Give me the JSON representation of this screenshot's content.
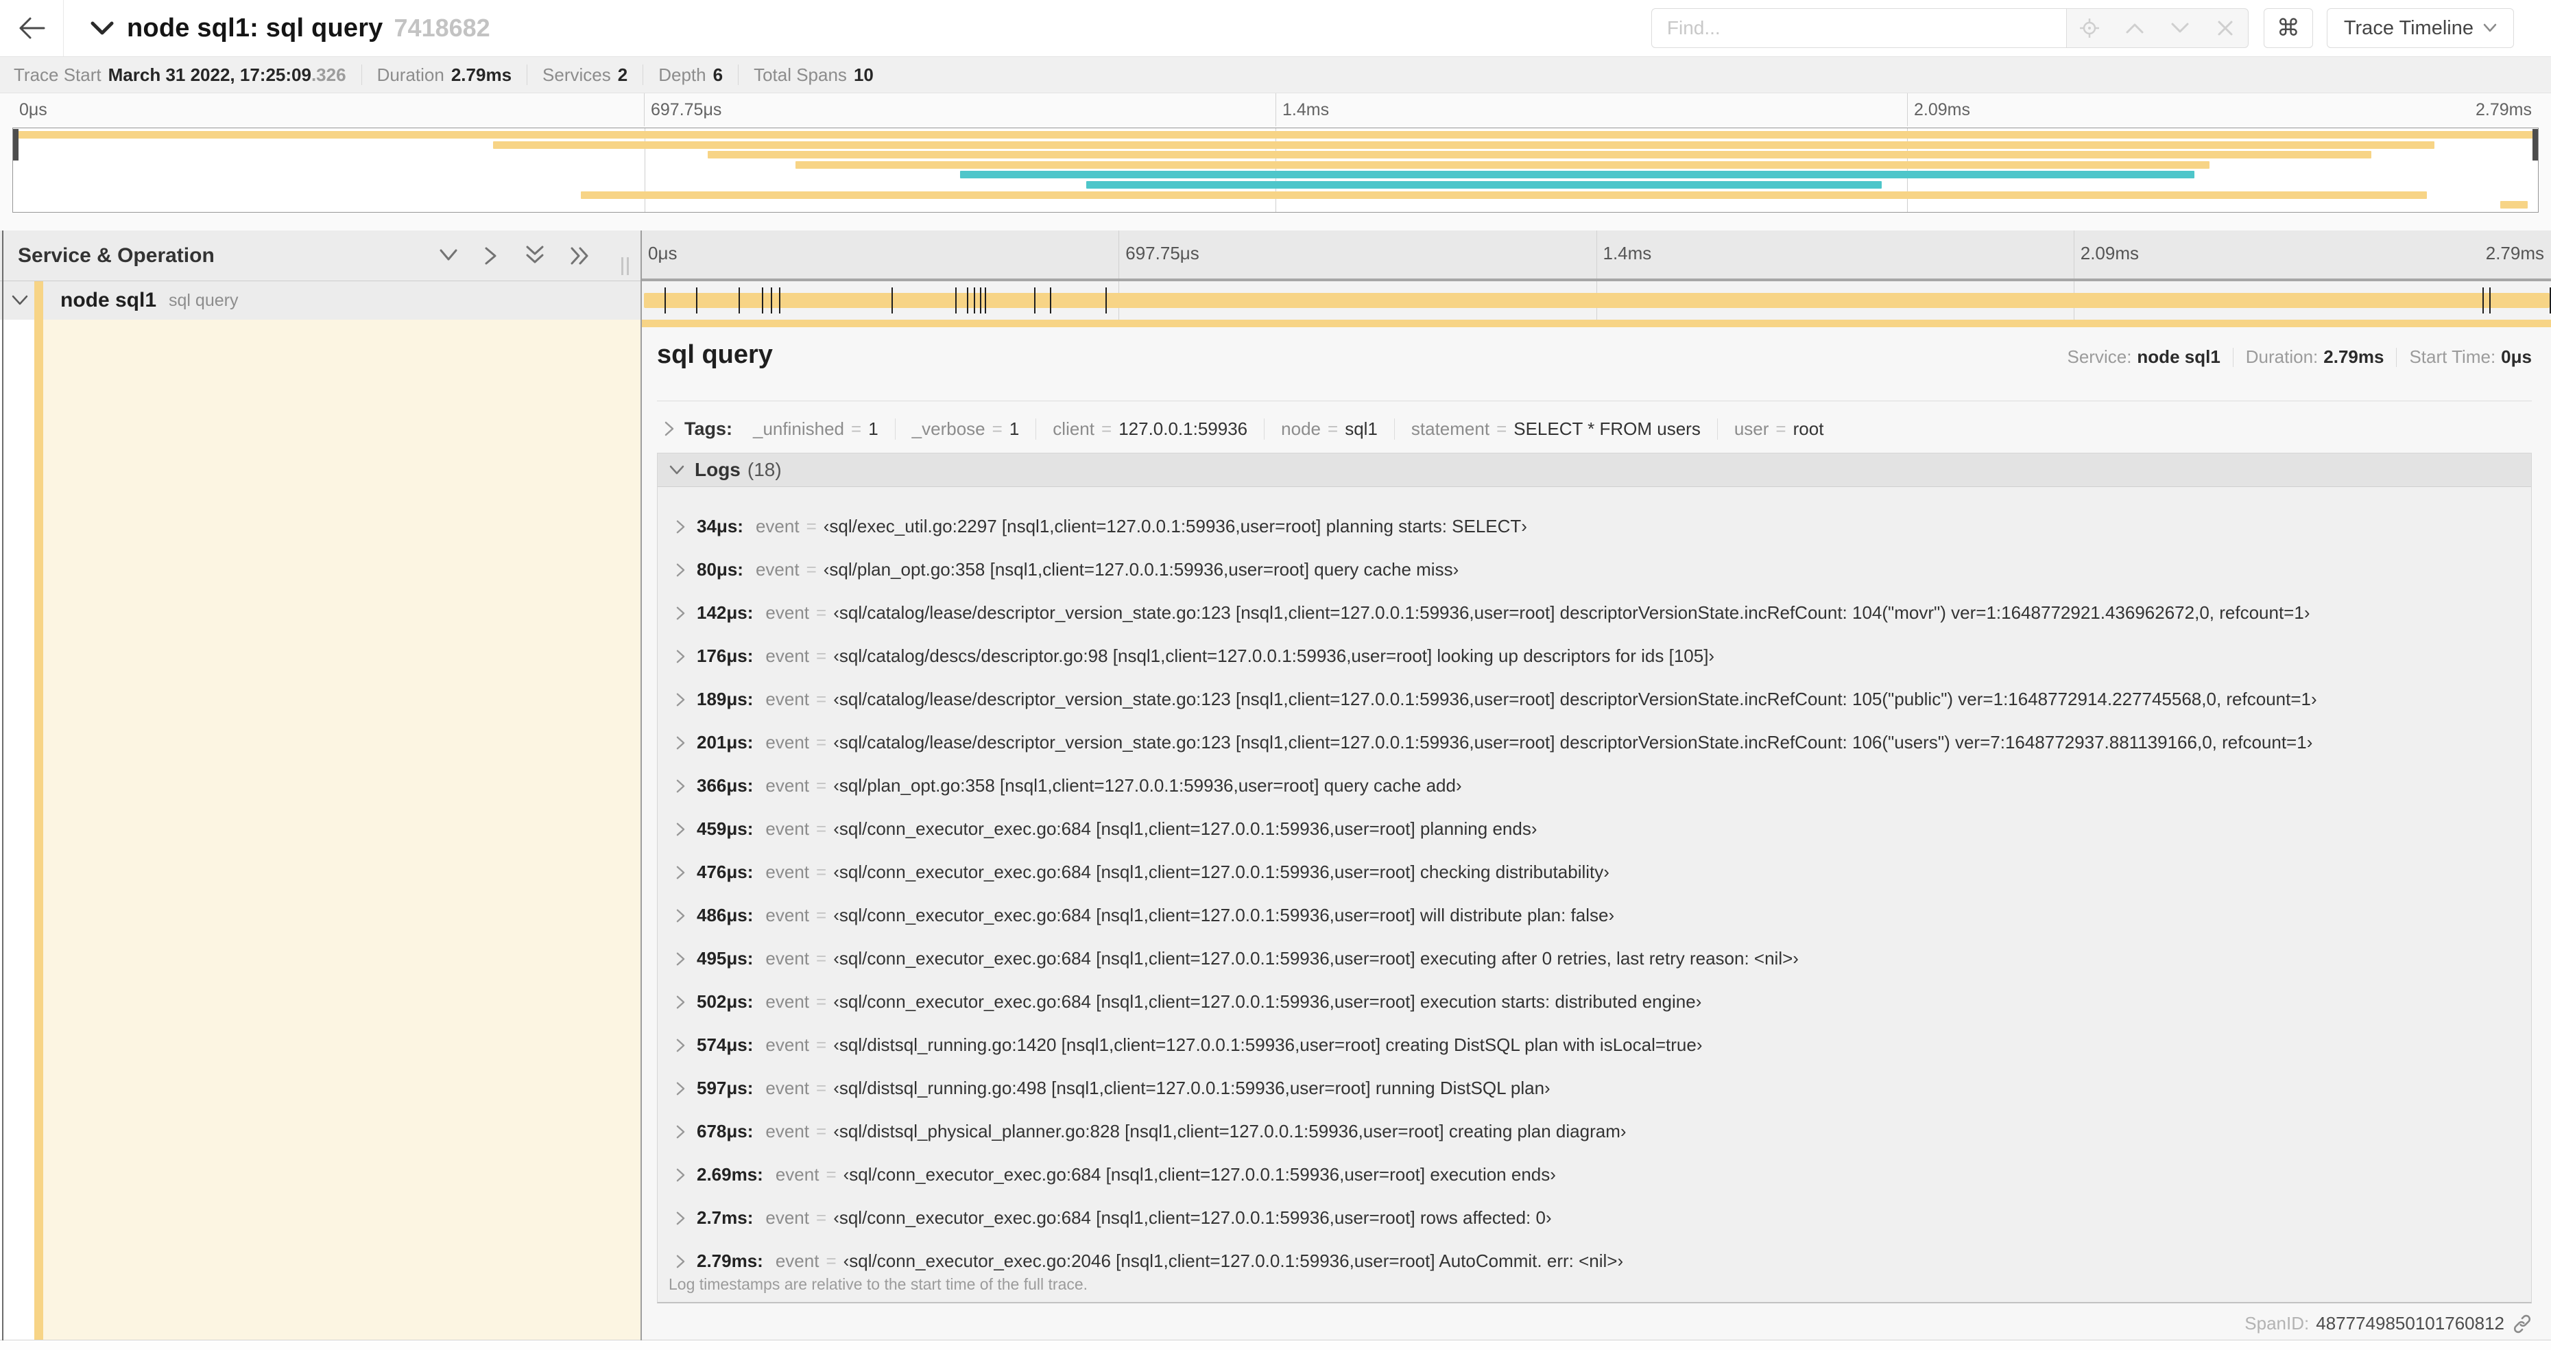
{
  "header": {
    "title": "node sql1: sql query",
    "trace_id": "7418682",
    "find_placeholder": "Find...",
    "shortcut_label": "⌘",
    "view_selector": "Trace Timeline"
  },
  "summary": {
    "items": [
      {
        "label": "Trace Start",
        "value": "March 31 2022, 17:25:09",
        "suffix": ".326"
      },
      {
        "label": "Duration",
        "value": "2.79ms",
        "suffix": ""
      },
      {
        "label": "Services",
        "value": "2",
        "suffix": ""
      },
      {
        "label": "Depth",
        "value": "6",
        "suffix": ""
      },
      {
        "label": "Total Spans",
        "value": "10",
        "suffix": ""
      }
    ]
  },
  "minimap": {
    "ticks": [
      "0μs",
      "697.75μs",
      "1.4ms",
      "2.09ms",
      "2.79ms"
    ],
    "spans": [
      {
        "start": 0,
        "end": 100,
        "color": "tan"
      },
      {
        "start": 19,
        "end": 95.9,
        "color": "tan"
      },
      {
        "start": 27.5,
        "end": 93.4,
        "color": "tan"
      },
      {
        "start": 31,
        "end": 87,
        "color": "tan"
      },
      {
        "start": 37.5,
        "end": 86.4,
        "color": "teal"
      },
      {
        "start": 42.5,
        "end": 74,
        "color": "teal"
      },
      {
        "start": 22.5,
        "end": 95.6,
        "color": "tan"
      },
      {
        "start": 98.5,
        "end": 99.6,
        "color": "tan"
      }
    ]
  },
  "timeline": {
    "left_header": "Service & Operation",
    "ticks": [
      "0μs",
      "697.75μs",
      "1.4ms",
      "2.09ms",
      "2.79ms"
    ],
    "duration_us": 2790,
    "row": {
      "service": "node sql1",
      "operation": "sql query"
    }
  },
  "detail": {
    "operation": "sql query",
    "overview": [
      {
        "label": "Service:",
        "value": "node sql1"
      },
      {
        "label": "Duration:",
        "value": "2.79ms"
      },
      {
        "label": "Start Time:",
        "value": "0μs"
      }
    ],
    "tags_label": "Tags:",
    "tags": [
      {
        "key": "_unfinished",
        "value": "1"
      },
      {
        "key": "_verbose",
        "value": "1"
      },
      {
        "key": "client",
        "value": "127.0.0.1:59936"
      },
      {
        "key": "node",
        "value": "sql1"
      },
      {
        "key": "statement",
        "value": "SELECT * FROM users"
      },
      {
        "key": "user",
        "value": "root"
      }
    ],
    "logs_label": "Logs",
    "logs_count": "(18)",
    "logs": [
      {
        "time": "34μs:",
        "key": "event",
        "value": "‹sql/exec_util.go:2297 [nsql1,client=127.0.0.1:59936,user=root] planning starts: SELECT›"
      },
      {
        "time": "80μs:",
        "key": "event",
        "value": "‹sql/plan_opt.go:358 [nsql1,client=127.0.0.1:59936,user=root] query cache miss›"
      },
      {
        "time": "142μs:",
        "key": "event",
        "value": "‹sql/catalog/lease/descriptor_version_state.go:123 [nsql1,client=127.0.0.1:59936,user=root] descriptorVersionState.incRefCount: 104(\"movr\") ver=1:1648772921.436962672,0, refcount=1›"
      },
      {
        "time": "176μs:",
        "key": "event",
        "value": "‹sql/catalog/descs/descriptor.go:98 [nsql1,client=127.0.0.1:59936,user=root] looking up descriptors for ids [105]›"
      },
      {
        "time": "189μs:",
        "key": "event",
        "value": "‹sql/catalog/lease/descriptor_version_state.go:123 [nsql1,client=127.0.0.1:59936,user=root] descriptorVersionState.incRefCount: 105(\"public\") ver=1:1648772914.227745568,0, refcount=1›"
      },
      {
        "time": "201μs:",
        "key": "event",
        "value": "‹sql/catalog/lease/descriptor_version_state.go:123 [nsql1,client=127.0.0.1:59936,user=root] descriptorVersionState.incRefCount: 106(\"users\") ver=7:1648772937.881139166,0, refcount=1›"
      },
      {
        "time": "366μs:",
        "key": "event",
        "value": "‹sql/plan_opt.go:358 [nsql1,client=127.0.0.1:59936,user=root] query cache add›"
      },
      {
        "time": "459μs:",
        "key": "event",
        "value": "‹sql/conn_executor_exec.go:684 [nsql1,client=127.0.0.1:59936,user=root] planning ends›"
      },
      {
        "time": "476μs:",
        "key": "event",
        "value": "‹sql/conn_executor_exec.go:684 [nsql1,client=127.0.0.1:59936,user=root] checking distributability›"
      },
      {
        "time": "486μs:",
        "key": "event",
        "value": "‹sql/conn_executor_exec.go:684 [nsql1,client=127.0.0.1:59936,user=root] will distribute plan: false›"
      },
      {
        "time": "495μs:",
        "key": "event",
        "value": "‹sql/conn_executor_exec.go:684 [nsql1,client=127.0.0.1:59936,user=root] executing after 0 retries, last retry reason: <nil>›"
      },
      {
        "time": "502μs:",
        "key": "event",
        "value": "‹sql/conn_executor_exec.go:684 [nsql1,client=127.0.0.1:59936,user=root] execution starts: distributed engine›"
      },
      {
        "time": "574μs:",
        "key": "event",
        "value": "‹sql/distsql_running.go:1420 [nsql1,client=127.0.0.1:59936,user=root] creating DistSQL plan with isLocal=true›"
      },
      {
        "time": "597μs:",
        "key": "event",
        "value": "‹sql/distsql_running.go:498 [nsql1,client=127.0.0.1:59936,user=root] running DistSQL plan›"
      },
      {
        "time": "678μs:",
        "key": "event",
        "value": "‹sql/distsql_physical_planner.go:828 [nsql1,client=127.0.0.1:59936,user=root] creating plan diagram›"
      },
      {
        "time": "2.69ms:",
        "key": "event",
        "value": "‹sql/conn_executor_exec.go:684 [nsql1,client=127.0.0.1:59936,user=root] execution ends›"
      },
      {
        "time": "2.7ms:",
        "key": "event",
        "value": "‹sql/conn_executor_exec.go:684 [nsql1,client=127.0.0.1:59936,user=root] rows affected: 0›"
      },
      {
        "time": "2.79ms:",
        "key": "event",
        "value": "‹sql/conn_executor_exec.go:2046 [nsql1,client=127.0.0.1:59936,user=root] AutoCommit. err: <nil>›"
      }
    ],
    "logs_note": "Log timestamps are relative to the start time of the full trace.",
    "span_id_label": "SpanID:",
    "span_id": "4877749850101760812"
  },
  "colors": {
    "span_tan": "#f7d486",
    "span_teal": "#4ec6ca",
    "detail_cream": "#fcf5e2",
    "marker": "#1f1f1f"
  }
}
